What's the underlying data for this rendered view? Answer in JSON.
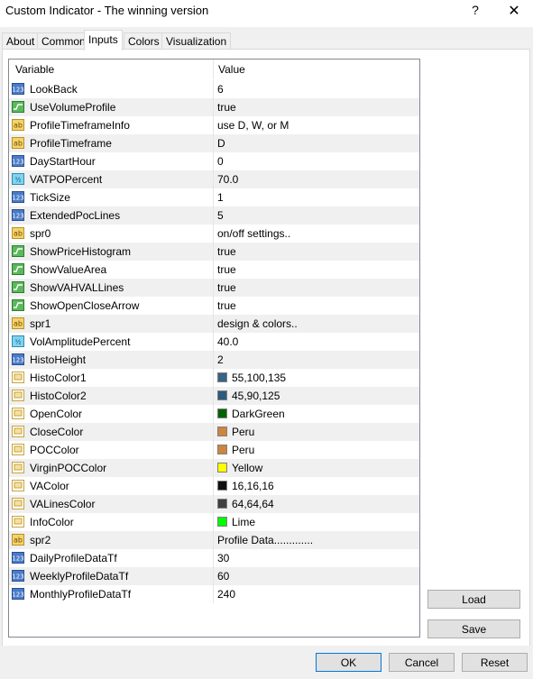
{
  "window": {
    "title": "Custom Indicator - The winning version",
    "help": "?",
    "close": "✕"
  },
  "tabs": [
    "About",
    "Common",
    "Inputs",
    "Colors",
    "Visualization"
  ],
  "active_tab": "Inputs",
  "table": {
    "columns": [
      "Variable",
      "Value"
    ],
    "rows": [
      {
        "icon": "int",
        "name": "LookBack",
        "value": "6"
      },
      {
        "icon": "bool",
        "name": "UseVolumeProfile",
        "value": "true"
      },
      {
        "icon": "str",
        "name": "ProfileTimeframeInfo",
        "value": "use D, W, or M"
      },
      {
        "icon": "str",
        "name": "ProfileTimeframe",
        "value": "D"
      },
      {
        "icon": "int",
        "name": "DayStartHour",
        "value": "0"
      },
      {
        "icon": "dbl",
        "name": "VATPOPercent",
        "value": "70.0"
      },
      {
        "icon": "int",
        "name": "TickSize",
        "value": "1"
      },
      {
        "icon": "int",
        "name": "ExtendedPocLines",
        "value": "5"
      },
      {
        "icon": "str",
        "name": "spr0",
        "value": "on/off settings.."
      },
      {
        "icon": "bool",
        "name": "ShowPriceHistogram",
        "value": "true"
      },
      {
        "icon": "bool",
        "name": "ShowValueArea",
        "value": "true"
      },
      {
        "icon": "bool",
        "name": "ShowVAHVALLines",
        "value": "true"
      },
      {
        "icon": "bool",
        "name": "ShowOpenCloseArrow",
        "value": "true"
      },
      {
        "icon": "str",
        "name": "spr1",
        "value": "design & colors.."
      },
      {
        "icon": "dbl",
        "name": "VolAmplitudePercent",
        "value": "40.0"
      },
      {
        "icon": "int",
        "name": "HistoHeight",
        "value": "2"
      },
      {
        "icon": "clr",
        "name": "HistoColor1",
        "value": "55,100,135",
        "swatch": "#376487"
      },
      {
        "icon": "clr",
        "name": "HistoColor2",
        "value": "45,90,125",
        "swatch": "#2d5a7d"
      },
      {
        "icon": "clr",
        "name": "OpenColor",
        "value": "DarkGreen",
        "swatch": "#006400"
      },
      {
        "icon": "clr",
        "name": "CloseColor",
        "value": "Peru",
        "swatch": "#cd853f"
      },
      {
        "icon": "clr",
        "name": "POCColor",
        "value": "Peru",
        "swatch": "#cd853f"
      },
      {
        "icon": "clr",
        "name": "VirginPOCColor",
        "value": "Yellow",
        "swatch": "#ffff00"
      },
      {
        "icon": "clr",
        "name": "VAColor",
        "value": "16,16,16",
        "swatch": "#101010"
      },
      {
        "icon": "clr",
        "name": "VALinesColor",
        "value": "64,64,64",
        "swatch": "#404040"
      },
      {
        "icon": "clr",
        "name": "InfoColor",
        "value": "Lime",
        "swatch": "#00ff00"
      },
      {
        "icon": "str",
        "name": "spr2",
        "value": "Profile Data............."
      },
      {
        "icon": "int",
        "name": "DailyProfileDataTf",
        "value": "30"
      },
      {
        "icon": "int",
        "name": "WeeklyProfileDataTf",
        "value": "60"
      },
      {
        "icon": "int",
        "name": "MonthlyProfileDataTf",
        "value": "240"
      }
    ]
  },
  "buttons": {
    "load": "Load",
    "save": "Save",
    "ok": "OK",
    "cancel": "Cancel",
    "reset": "Reset"
  }
}
